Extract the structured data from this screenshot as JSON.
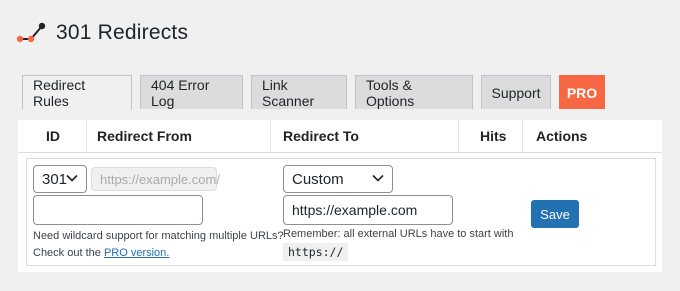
{
  "header": {
    "title": "301 Redirects",
    "logo_icon": "redirect-logo-icon"
  },
  "tabs": [
    {
      "label": "Redirect Rules",
      "active": true
    },
    {
      "label": "404 Error Log",
      "active": false
    },
    {
      "label": "Link Scanner",
      "active": false
    },
    {
      "label": "Tools & Options",
      "active": false
    },
    {
      "label": "Support",
      "active": false
    },
    {
      "label": "PRO",
      "active": false
    }
  ],
  "table": {
    "columns": [
      "ID",
      "Redirect From",
      "Redirect To",
      "Hits",
      "Actions"
    ]
  },
  "row": {
    "code_select": "301",
    "from_prefix_placeholder": "https://example.com/",
    "from_input_value": "",
    "hint_line1": "Need wildcard support for matching multiple URLs?",
    "hint_line2_prefix": "Check out the ",
    "hint_link": "PRO version.",
    "to_select": "Custom",
    "to_input_value": "https://example.com",
    "to_hint": "Remember: all external URLs have to start with",
    "to_code": "https://",
    "save_label": "Save"
  },
  "colors": {
    "accent": "#2271b1",
    "pro": "#f86743",
    "background": "#f0f0f1"
  }
}
